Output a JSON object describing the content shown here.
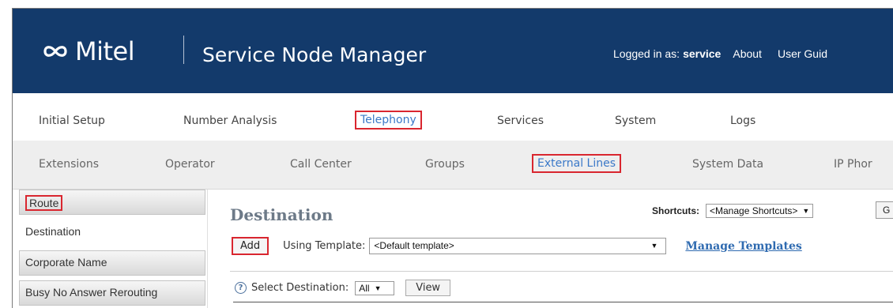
{
  "header": {
    "brand": "Mitel",
    "app_title": "Service Node Manager",
    "logged_in_label": "Logged in as:",
    "username": "service",
    "about": "About",
    "user_guide": "User Guid"
  },
  "main_nav": [
    {
      "label": "Initial Setup",
      "active": false
    },
    {
      "label": "Number Analysis",
      "active": false
    },
    {
      "label": "Telephony",
      "active": true
    },
    {
      "label": "Services",
      "active": false
    },
    {
      "label": "System",
      "active": false
    },
    {
      "label": "Logs",
      "active": false
    }
  ],
  "sub_nav": [
    {
      "label": "Extensions",
      "active": false
    },
    {
      "label": "Operator",
      "active": false
    },
    {
      "label": "Call Center",
      "active": false
    },
    {
      "label": "Groups",
      "active": false
    },
    {
      "label": "External Lines",
      "active": true
    },
    {
      "label": "System Data",
      "active": false
    },
    {
      "label": "IP Phor",
      "active": false
    }
  ],
  "sidebar": {
    "items": [
      {
        "label": "Route",
        "highlighted": true
      },
      {
        "label": "Destination",
        "selected": true
      },
      {
        "label": "Corporate Name"
      },
      {
        "label": "Busy No Answer Rerouting"
      }
    ]
  },
  "content": {
    "title": "Destination",
    "shortcuts_label": "Shortcuts:",
    "shortcuts_value": "<Manage Shortcuts>",
    "go_button": "G",
    "add_button": "Add",
    "using_template_label": "Using Template:",
    "template_value": "<Default template>",
    "manage_templates": "Manage Templates",
    "select_destination_label": "Select Destination:",
    "select_destination_value": "All",
    "view_button": "View"
  },
  "colors": {
    "header_bg": "#133a6b",
    "highlight_box": "#d9262f",
    "active_link": "#3a78c8"
  }
}
